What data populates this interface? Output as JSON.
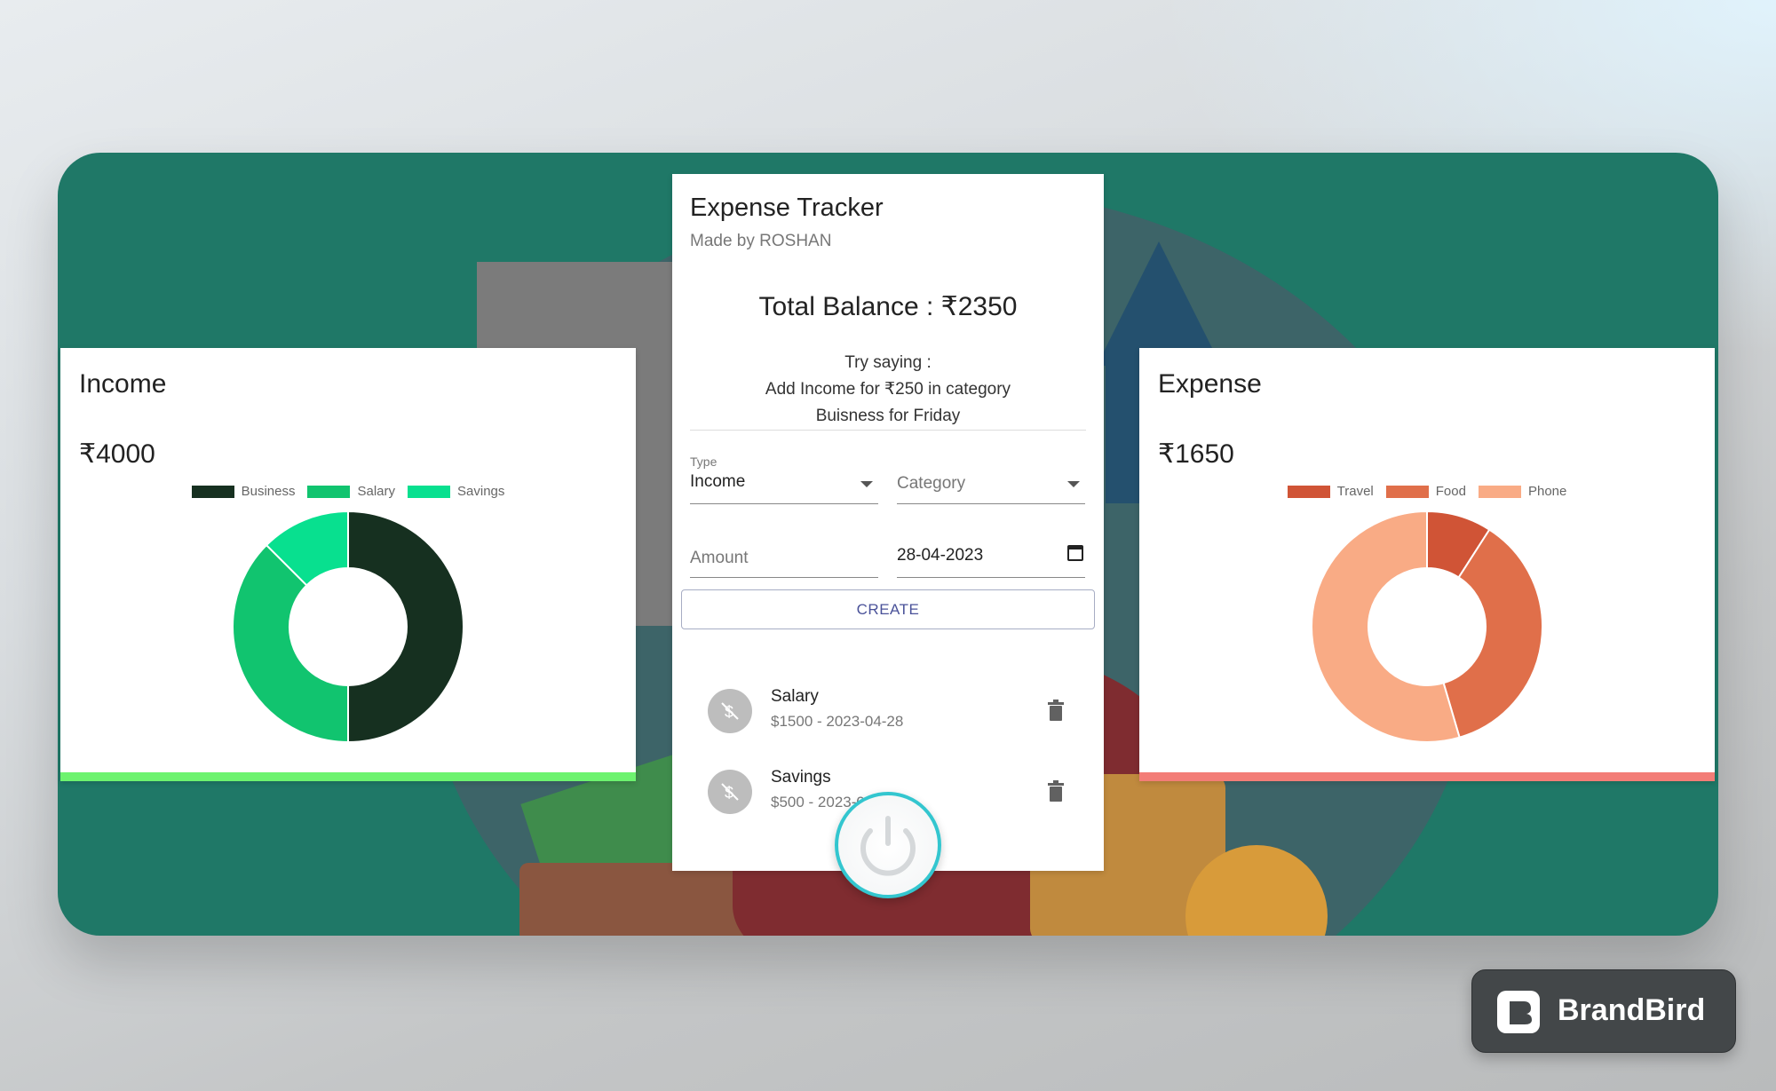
{
  "income": {
    "title": "Income",
    "amount": "₹4000",
    "legend": [
      {
        "label": "Business",
        "color": "#163020"
      },
      {
        "label": "Salary",
        "color": "#11c46f"
      },
      {
        "label": "Savings",
        "color": "#08e08f"
      }
    ],
    "accent": "#6df36f"
  },
  "expense": {
    "title": "Expense",
    "amount": "₹1650",
    "legend": [
      {
        "label": "Travel",
        "color": "#d05436"
      },
      {
        "label": "Food",
        "color": "#e06f4a"
      },
      {
        "label": "Phone",
        "color": "#f9ab85"
      }
    ],
    "accent": "#f37d77"
  },
  "chart_data": [
    {
      "type": "pie",
      "categories": [
        "Business",
        "Salary",
        "Savings"
      ],
      "values": [
        2000,
        1500,
        500
      ],
      "colors": [
        "#163020",
        "#11c46f",
        "#08e08f"
      ]
    },
    {
      "type": "pie",
      "categories": [
        "Travel",
        "Food",
        "Phone"
      ],
      "values": [
        150,
        600,
        900
      ],
      "colors": [
        "#d05436",
        "#e06f4a",
        "#f9ab85"
      ]
    }
  ],
  "tracker": {
    "title": "Expense Tracker",
    "subtitle": "Made by ROSHAN",
    "balance": "Total Balance : ₹2350",
    "hint_line1": "Try saying :",
    "hint_line2": "Add Income for ₹250 in category",
    "hint_line3": "Buisness for Friday",
    "type_label": "Type",
    "type_value": "Income",
    "category_placeholder": "Category",
    "amount_placeholder": "Amount",
    "date_value": "28-04-2023",
    "create_label": "CREATE",
    "transactions": [
      {
        "name": "Salary",
        "detail": "$1500 - 2023-04-28"
      },
      {
        "name": "Savings",
        "detail": "$500 - 2023-04-28"
      }
    ]
  },
  "badge": {
    "text": "BrandBird"
  }
}
